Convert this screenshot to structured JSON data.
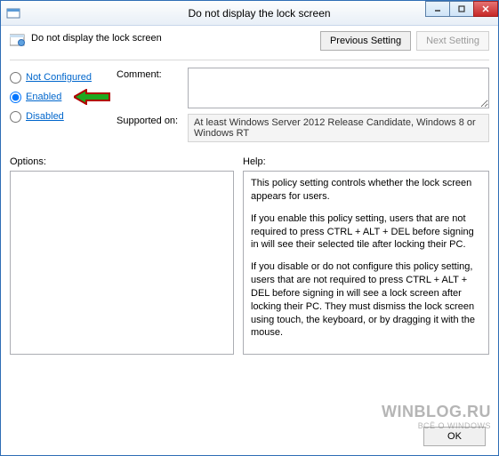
{
  "window": {
    "title": "Do not display the lock screen"
  },
  "header": {
    "policy_title": "Do not display the lock screen",
    "prev_button": "Previous Setting",
    "next_button": "Next Setting"
  },
  "radios": {
    "not_configured": "Not Configured",
    "enabled": "Enabled",
    "disabled": "Disabled",
    "selected": "enabled"
  },
  "fields": {
    "comment_label": "Comment:",
    "comment_value": "",
    "supported_label": "Supported on:",
    "supported_value": "At least Windows Server 2012 Release Candidate, Windows 8 or Windows RT"
  },
  "sections": {
    "options_label": "Options:",
    "help_label": "Help:"
  },
  "help": {
    "p1": "This policy setting controls whether the lock screen appears for users.",
    "p2": "If you enable this policy setting, users that are not required to press CTRL + ALT + DEL before signing in will see their selected tile after  locking their PC.",
    "p3": "If you disable or do not configure this policy setting, users that are not required to press CTRL + ALT + DEL before signing in will see a lock screen after locking their PC. They must dismiss the lock screen using touch, the keyboard, or by dragging it with the mouse."
  },
  "footer": {
    "ok": "OK"
  },
  "watermark": {
    "main": "WINBLOG.RU",
    "sub": "ВСЁ О WINDOWS"
  }
}
